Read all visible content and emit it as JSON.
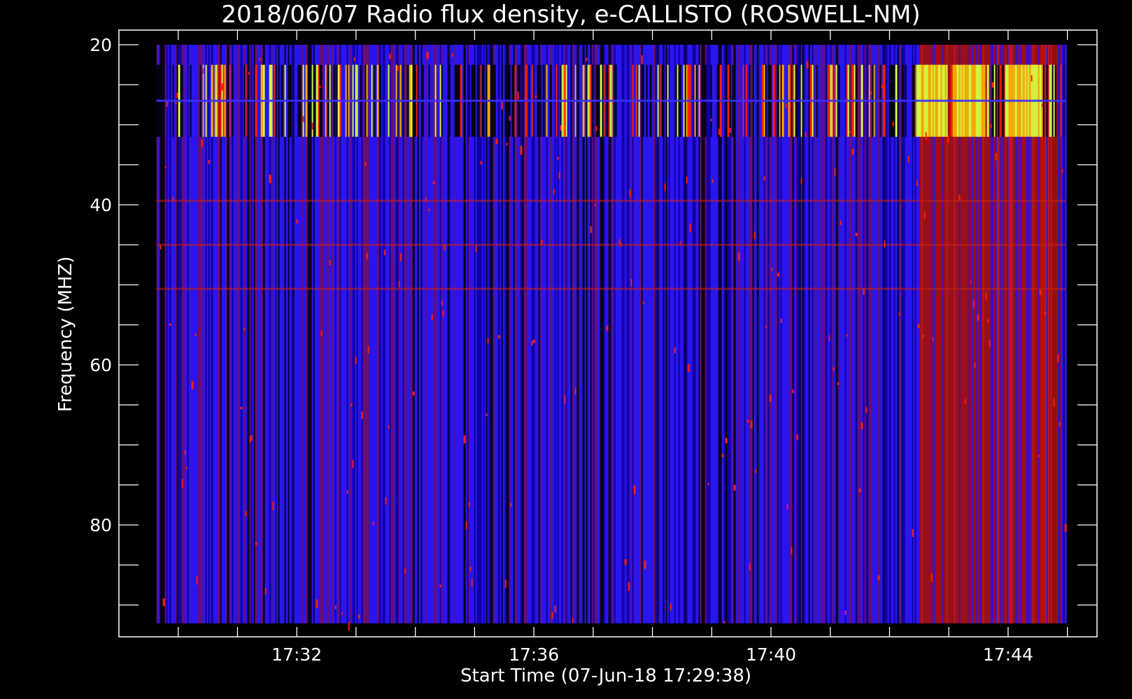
{
  "chart_data": {
    "type": "heatmap",
    "title": "2018/06/07  Radio flux density, e-CALLISTO (ROSWELL-NM)",
    "xlabel": "Start Time (07-Jun-18 17:29:38)",
    "ylabel": "Frequency (MHZ)",
    "x_ticks": [
      {
        "label": "17:32",
        "minute": 32
      },
      {
        "label": "17:36",
        "minute": 36
      },
      {
        "label": "17:40",
        "minute": 40
      },
      {
        "label": "17:44",
        "minute": 44
      }
    ],
    "x_minor_step_min": 1,
    "xlim_min": [
      29.0,
      45.5
    ],
    "data_x_range_min": [
      29.633,
      44.967
    ],
    "y_ticks": [
      {
        "label": "20",
        "value": 20
      },
      {
        "label": "40",
        "value": 40
      },
      {
        "label": "60",
        "value": 60
      },
      {
        "label": "80",
        "value": 80
      }
    ],
    "y_minor_step": 5,
    "ylim_mhz": [
      20,
      94
    ],
    "data_y_range_mhz": [
      20,
      92.3
    ],
    "y_inverted": true,
    "colormap": [
      "#000000",
      "#1a00ff",
      "#ff2000",
      "#ffb000",
      "#d8ff40"
    ],
    "features": [
      {
        "kind": "vertical_bursts",
        "freq_mhz": [
          22.5,
          31.5
        ],
        "intensity": "high",
        "strongest_near_min": [
          42.6,
          42.8,
          43.2,
          43.4,
          44.1,
          44.4
        ]
      },
      {
        "kind": "horizontal_interference",
        "freq_mhz": [
          27,
          39.5,
          45,
          50.5
        ]
      },
      {
        "kind": "enhanced_emission",
        "time_min": [
          42.5,
          44.9
        ],
        "freq_mhz": [
          30,
          92
        ]
      }
    ]
  }
}
